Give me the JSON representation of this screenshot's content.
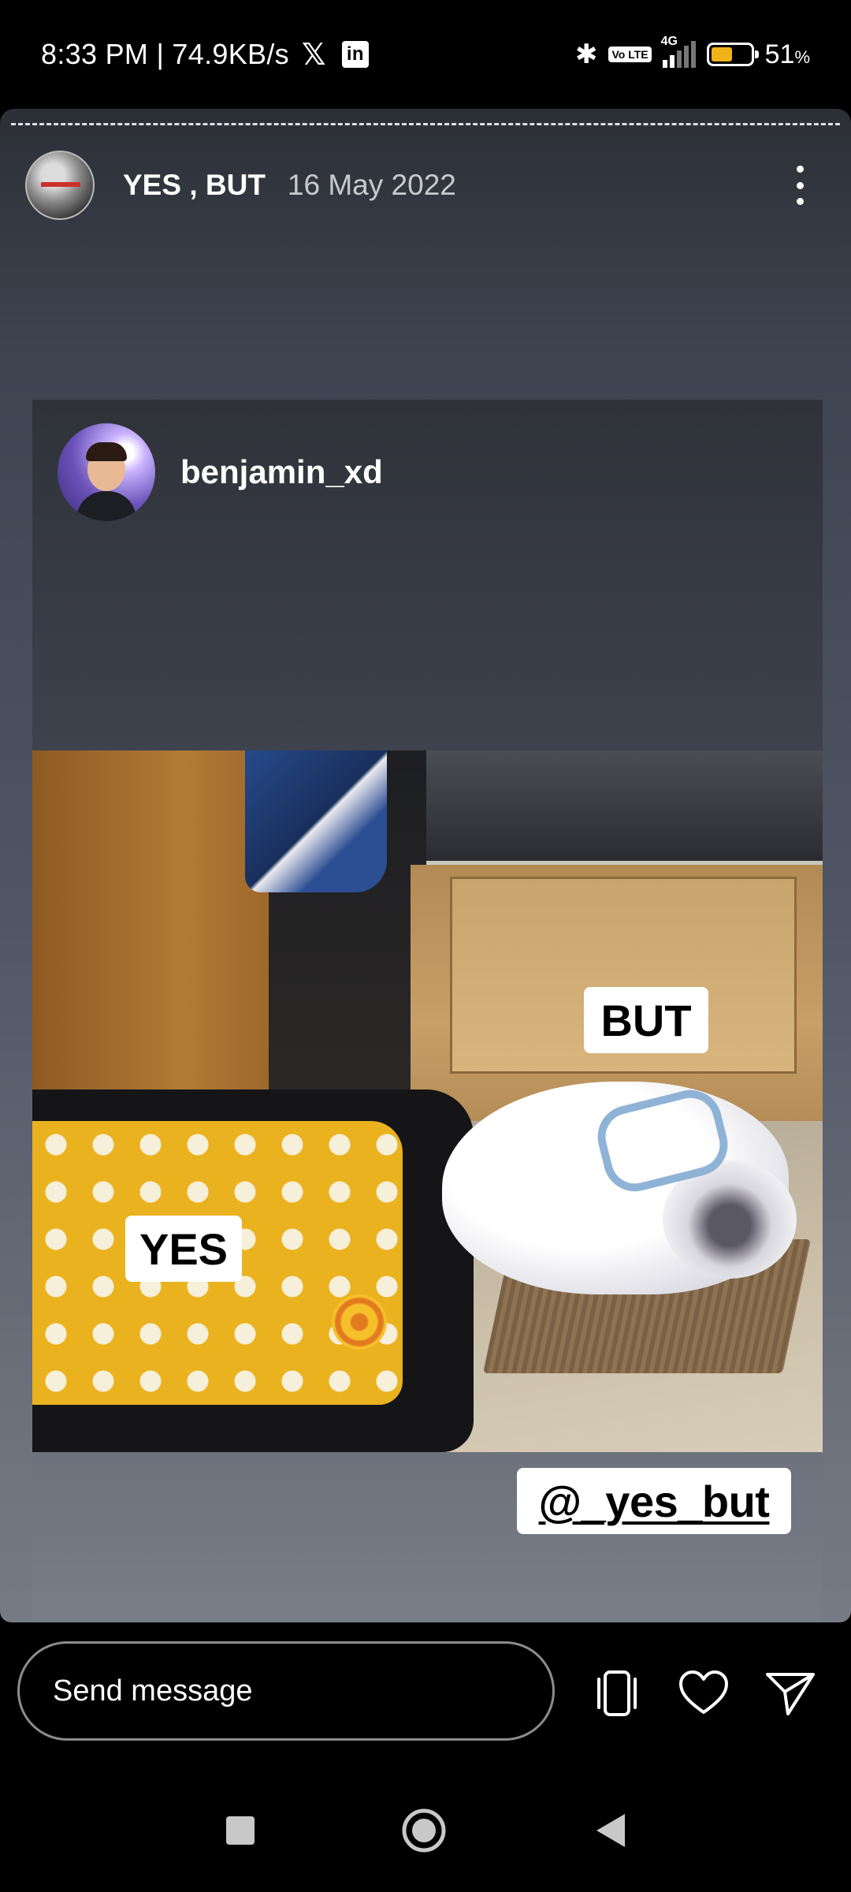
{
  "status_bar": {
    "time_speed": "8:33 PM | 74.9KB/s",
    "x_icon": "x-logo-icon",
    "linkedin_label": "in",
    "volte": "Vo LTE",
    "network": "4G",
    "battery_pct": "51",
    "battery_unit": "%",
    "battery_color": "#f2b21a"
  },
  "story": {
    "username": "YES , BUT",
    "date": "16 May 2022",
    "more_icon": "more-vertical-icon"
  },
  "post": {
    "username": "benjamin_xd",
    "tag_yes": "YES",
    "tag_but": "BUT",
    "mention": "@_yes_but"
  },
  "message_bar": {
    "placeholder": "Send message",
    "icons": [
      "rotate-device-icon",
      "heart-icon",
      "send-icon"
    ]
  },
  "nav_bar": {
    "icons": [
      "recents-icon",
      "home-icon",
      "back-icon"
    ]
  }
}
